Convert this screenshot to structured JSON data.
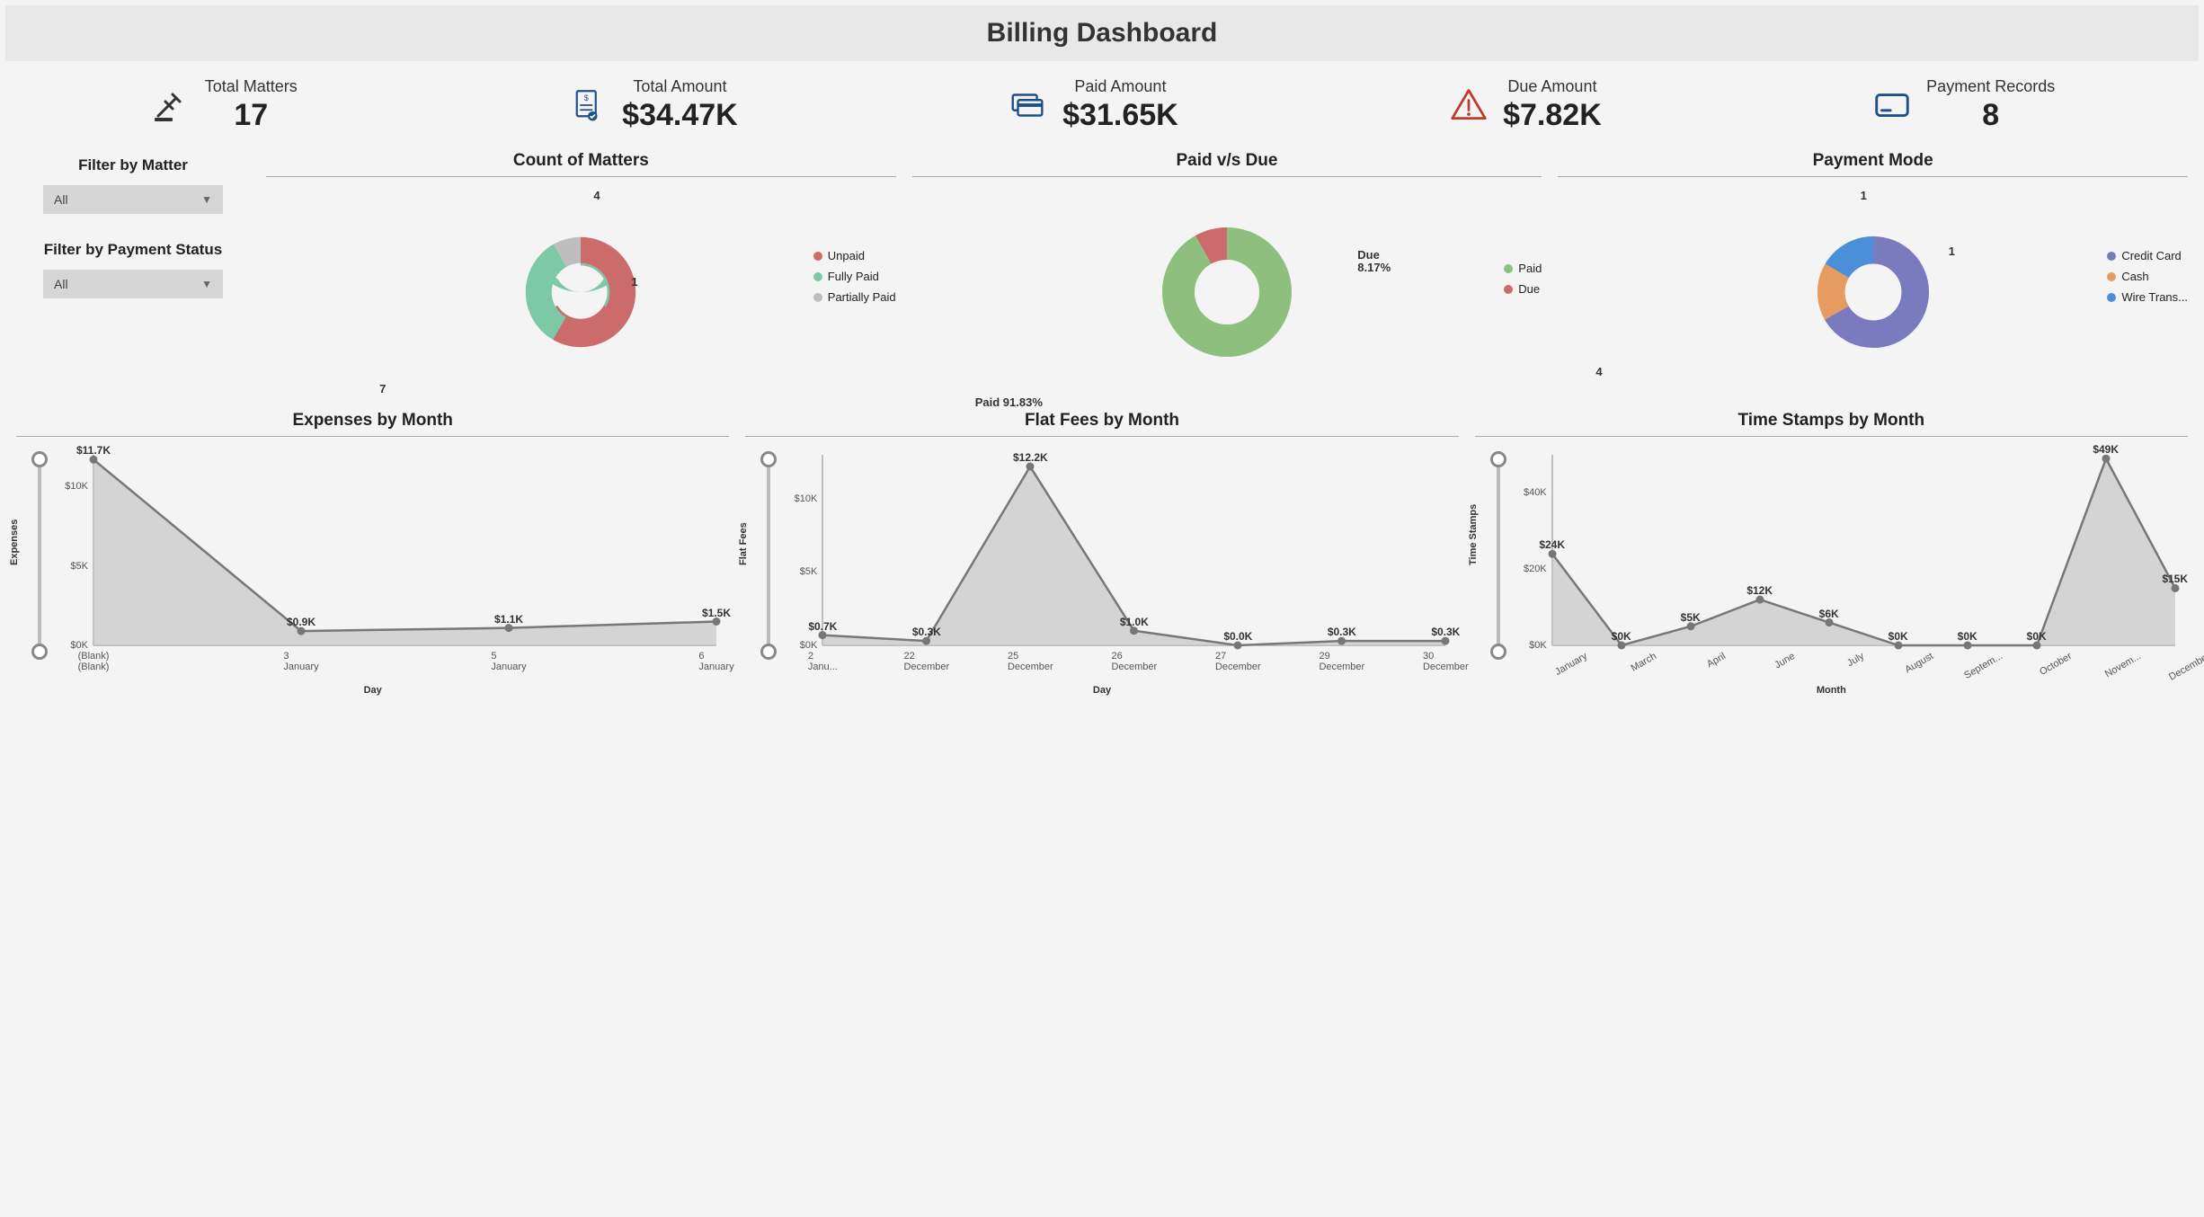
{
  "title": "Billing Dashboard",
  "kpis": {
    "matters": {
      "label": "Total Matters",
      "value": "17"
    },
    "total": {
      "label": "Total Amount",
      "value": "$34.47K"
    },
    "paid": {
      "label": "Paid Amount",
      "value": "$31.65K"
    },
    "due": {
      "label": "Due Amount",
      "value": "$7.82K"
    },
    "records": {
      "label": "Payment Records",
      "value": "8"
    }
  },
  "filters": {
    "matter": {
      "label": "Filter by Matter",
      "value": "All"
    },
    "status": {
      "label": "Filter by Payment Status",
      "value": "All"
    }
  },
  "charts": {
    "count_matters_title": "Count of Matters",
    "paid_due_title": "Paid v/s Due",
    "payment_mode_title": "Payment Mode",
    "expenses_title": "Expenses by Month",
    "flatfees_title": "Flat Fees by Month",
    "timestamps_title": "Time Stamps by Month"
  },
  "legend": {
    "unpaid": "Unpaid",
    "fully_paid": "Fully Paid",
    "partially_paid": "Partially Paid",
    "paid": "Paid",
    "due": "Due",
    "credit_card": "Credit Card",
    "cash": "Cash",
    "wire": "Wire Trans..."
  },
  "labels": {
    "count_7": "7",
    "count_4": "4",
    "count_1": "1",
    "paid_pct": "Paid 91.83%",
    "due_pct": "Due",
    "due_pct2": "8.17%",
    "mode_4": "4",
    "mode_1a": "1",
    "mode_1b": "1"
  },
  "axis": {
    "expenses_y": "Expenses",
    "flatfees_y": "Flat Fees",
    "timestamps_y": "Time Stamps",
    "day": "Day",
    "month": "Month",
    "blank": "(Blank)",
    "january": "January",
    "december": "December",
    "janu": "Janu..."
  },
  "chart_data": [
    {
      "type": "pie",
      "title": "Count of Matters",
      "series": [
        {
          "name": "Unpaid",
          "value": 7,
          "color": "#cc6b6b"
        },
        {
          "name": "Fully Paid",
          "value": 4,
          "color": "#7dc8a6"
        },
        {
          "name": "Partially Paid",
          "value": 1,
          "color": "#bdbdbd"
        }
      ]
    },
    {
      "type": "pie",
      "title": "Paid v/s Due",
      "series": [
        {
          "name": "Paid",
          "value": 91.83,
          "color": "#8fbf7f"
        },
        {
          "name": "Due",
          "value": 8.17,
          "color": "#cc6b6b"
        }
      ]
    },
    {
      "type": "pie",
      "title": "Payment Mode",
      "series": [
        {
          "name": "Credit Card",
          "value": 4,
          "color": "#7a7abf"
        },
        {
          "name": "Cash",
          "value": 1,
          "color": "#e89b5f"
        },
        {
          "name": "Wire Transfer",
          "value": 1,
          "color": "#4b8fd8"
        }
      ]
    },
    {
      "type": "area",
      "title": "Expenses by Month",
      "xlabel": "Day",
      "ylabel": "Expenses",
      "ylim": [
        0,
        12000
      ],
      "x": [
        "(Blank) (Blank)",
        "3 January",
        "5 January",
        "6 January"
      ],
      "values": [
        11700,
        900,
        1100,
        1500
      ],
      "value_labels": [
        "$11.7K",
        "$0.9K",
        "$1.1K",
        "$1.5K"
      ]
    },
    {
      "type": "area",
      "title": "Flat Fees by Month",
      "xlabel": "Day",
      "ylabel": "Flat Fees",
      "ylim": [
        0,
        13000
      ],
      "x": [
        "2 Janu...",
        "22 December",
        "25 December",
        "26 December",
        "27 December",
        "29 December",
        "30 December"
      ],
      "values": [
        700,
        300,
        12200,
        1000,
        0,
        300,
        300
      ],
      "value_labels": [
        "$0.7K",
        "$0.3K",
        "$12.2K",
        "$1.0K",
        "$0.0K",
        "$0.3K",
        "$0.3K"
      ]
    },
    {
      "type": "area",
      "title": "Time Stamps by Month",
      "xlabel": "Month",
      "ylabel": "Time Stamps",
      "ylim": [
        0,
        50000
      ],
      "x": [
        "January",
        "March",
        "April",
        "June",
        "July",
        "August",
        "Septem...",
        "October",
        "Novem...",
        "December"
      ],
      "values": [
        24000,
        0,
        5000,
        12000,
        6000,
        0,
        0,
        0,
        49000,
        15000
      ],
      "value_labels": [
        "$24K",
        "$0K",
        "$5K",
        "$12K",
        "$6K",
        "$0K",
        "$0K",
        "$0K",
        "$49K",
        "$15K"
      ]
    }
  ]
}
